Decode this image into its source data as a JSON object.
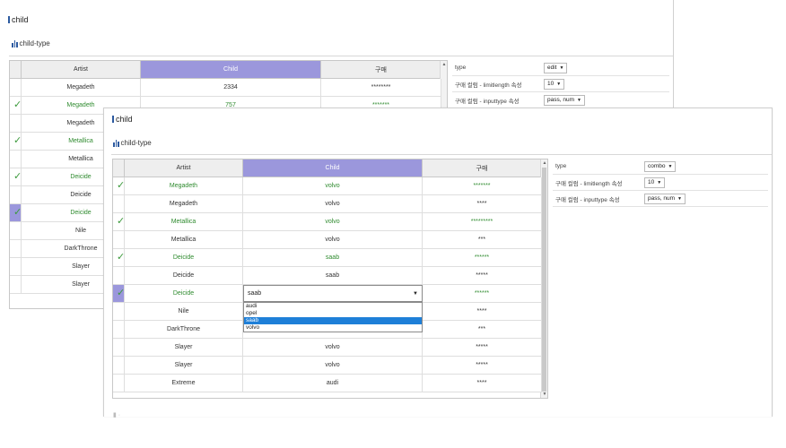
{
  "back": {
    "title": "child",
    "subtitle": "child-type",
    "columns": [
      "Artist",
      "Child",
      "구매"
    ],
    "rows": [
      {
        "checked": false,
        "artist": "Megadeth",
        "child": "2334",
        "purchase": "********",
        "green": false
      },
      {
        "checked": true,
        "artist": "Megadeth",
        "child": "757",
        "purchase": "*******",
        "green": true
      },
      {
        "checked": false,
        "artist": "Megadeth",
        "child": "",
        "purchase": "",
        "green": false
      },
      {
        "checked": true,
        "artist": "Metallica",
        "child": "",
        "purchase": "",
        "green": true
      },
      {
        "checked": false,
        "artist": "Metallica",
        "child": "",
        "purchase": "",
        "green": false
      },
      {
        "checked": true,
        "artist": "Deicide",
        "child": "",
        "purchase": "",
        "green": true
      },
      {
        "checked": false,
        "artist": "Deicide",
        "child": "",
        "purchase": "",
        "green": false
      },
      {
        "checked": true,
        "artist": "Deicide",
        "child": "",
        "purchase": "",
        "green": true
      },
      {
        "checked": false,
        "artist": "Nile",
        "child": "",
        "purchase": "",
        "green": false
      },
      {
        "checked": false,
        "artist": "DarkThrone",
        "child": "",
        "purchase": "",
        "green": false
      },
      {
        "checked": false,
        "artist": "Slayer",
        "child": "",
        "purchase": "",
        "green": false
      },
      {
        "checked": false,
        "artist": "Slayer",
        "child": "",
        "purchase": "",
        "green": false
      }
    ],
    "props": [
      {
        "label": "type",
        "value": "edit"
      },
      {
        "label": "구매 컬럼 - limitlength 속성",
        "value": "10"
      },
      {
        "label": "구매 컬럼 - inputtype 속성",
        "value": "pass, num"
      }
    ]
  },
  "front": {
    "title": "child",
    "subtitle": "child-type",
    "columns": [
      "Artist",
      "Child",
      "구매"
    ],
    "rows": [
      {
        "checked": true,
        "artist": "Megadeth",
        "child": "volvo",
        "purchase": "*******",
        "green": true
      },
      {
        "checked": false,
        "artist": "Megadeth",
        "child": "volvo",
        "purchase": "****",
        "green": false
      },
      {
        "checked": true,
        "artist": "Metallica",
        "child": "volvo",
        "purchase": "*********",
        "green": true
      },
      {
        "checked": false,
        "artist": "Metallica",
        "child": "volvo",
        "purchase": "***",
        "green": false
      },
      {
        "checked": true,
        "artist": "Deicide",
        "child": "saab",
        "purchase": "******",
        "green": true
      },
      {
        "checked": false,
        "artist": "Deicide",
        "child": "saab",
        "purchase": "*****",
        "green": false
      },
      {
        "checked": true,
        "artist": "Deicide",
        "child": "saab",
        "purchase": "******",
        "green": true
      },
      {
        "checked": false,
        "artist": "Nile",
        "child": "",
        "purchase": "****",
        "green": false
      },
      {
        "checked": false,
        "artist": "DarkThrone",
        "child": "",
        "purchase": "***",
        "green": false
      },
      {
        "checked": false,
        "artist": "Slayer",
        "child": "volvo",
        "purchase": "*****",
        "green": false
      },
      {
        "checked": false,
        "artist": "Slayer",
        "child": "volvo",
        "purchase": "*****",
        "green": false
      },
      {
        "checked": false,
        "artist": "Extreme",
        "child": "audi",
        "purchase": "****",
        "green": false
      }
    ],
    "combo": {
      "value": "saab",
      "options": [
        "audi",
        "opel",
        "saab",
        "volvo"
      ],
      "selected": "saab"
    },
    "props": [
      {
        "label": "type",
        "value": "combo"
      },
      {
        "label": "구매 컬럼 - limitlength 속성",
        "value": "10"
      },
      {
        "label": "구매 컬럼 - inputtype 속성",
        "value": "pass, num"
      }
    ]
  },
  "colors": {
    "header_highlight": "#9b97dc",
    "check_green": "#3c9a3c",
    "combo_selected": "#1e7fd8"
  }
}
